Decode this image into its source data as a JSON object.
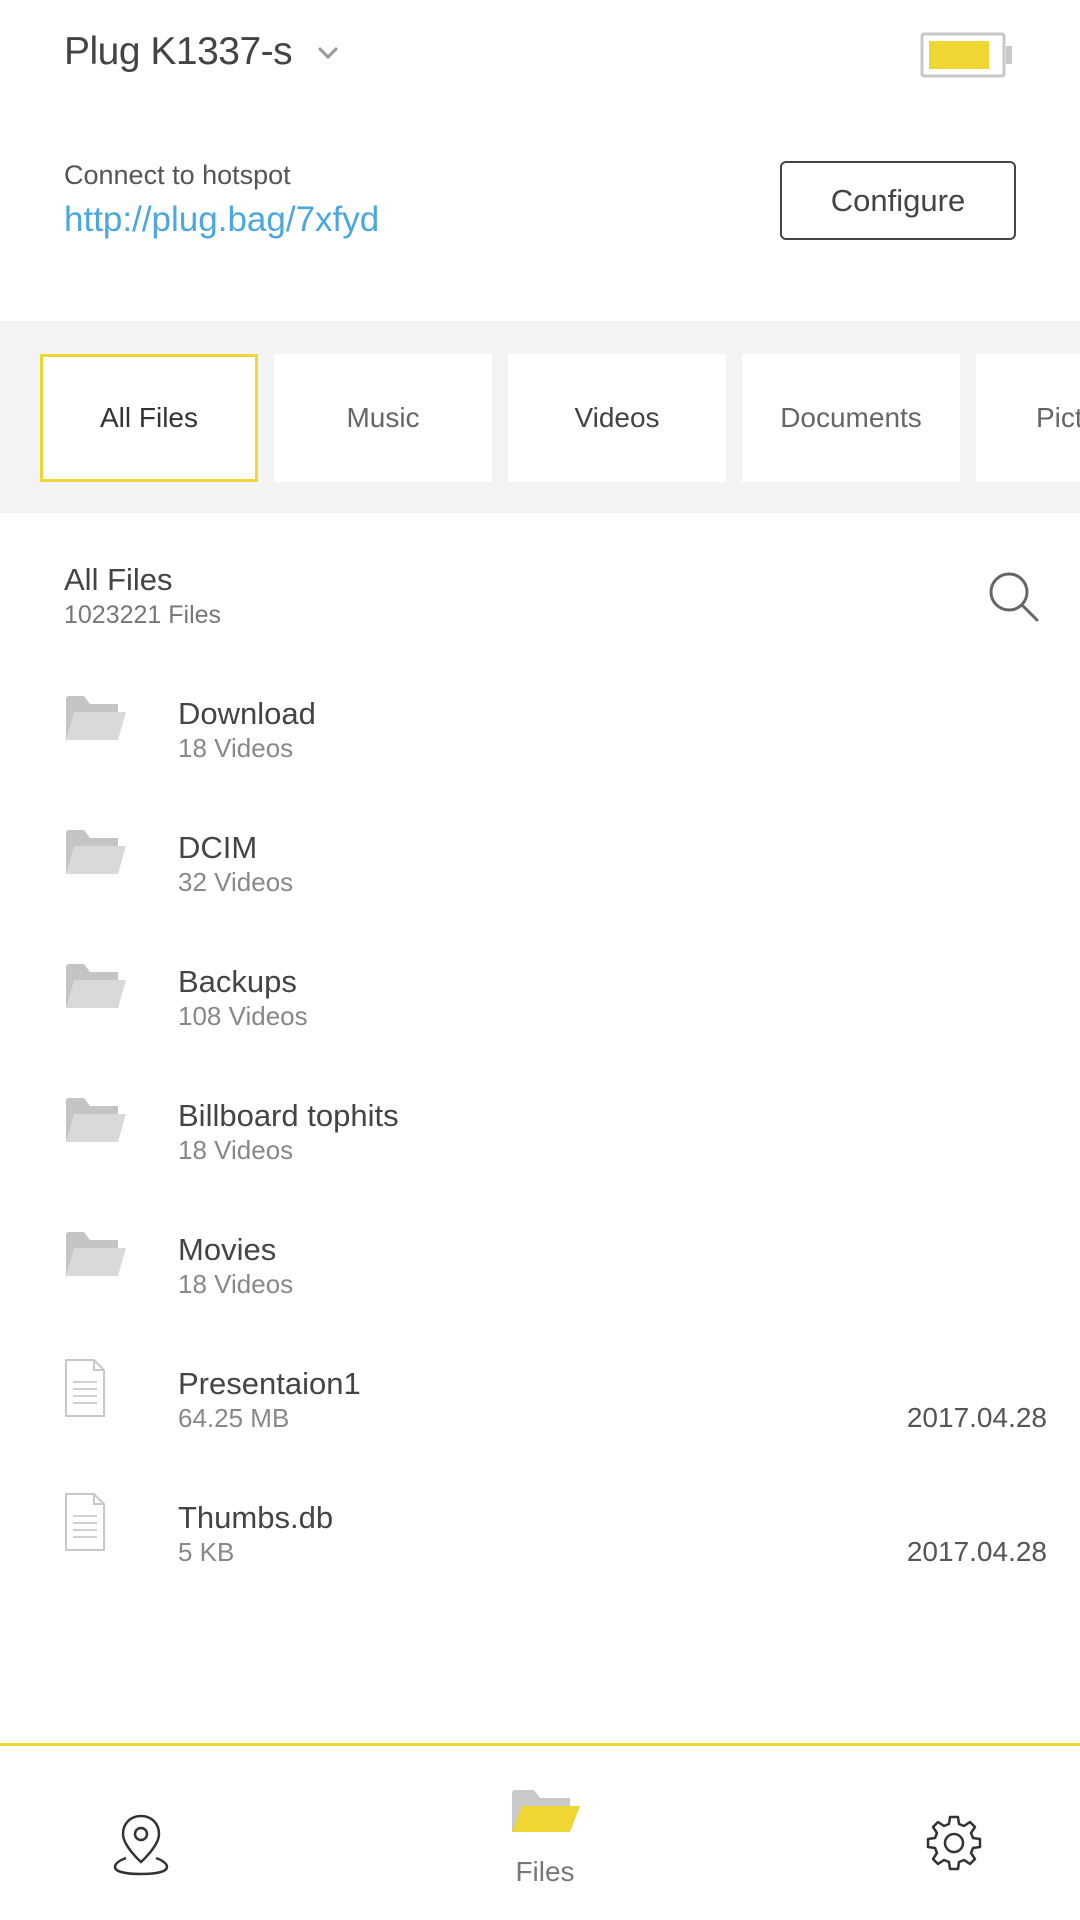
{
  "header": {
    "device_name": "Plug K1337-s",
    "hotspot_label": "Connect to hotspot",
    "hotspot_url": "http://plug.bag/7xfyd",
    "configure_label": "Configure",
    "battery_level": 0.85
  },
  "tabs": [
    {
      "label": "All Files",
      "active": true
    },
    {
      "label": "Music",
      "active": false
    },
    {
      "label": "Videos",
      "active": false
    },
    {
      "label": "Documents",
      "active": false
    },
    {
      "label": "Pict",
      "active": false
    }
  ],
  "section": {
    "title": "All Files",
    "count": "1023221 Files"
  },
  "files": [
    {
      "name": "Download",
      "sub": "18 Videos",
      "type": "folder",
      "date": ""
    },
    {
      "name": "DCIM",
      "sub": "32 Videos",
      "type": "folder",
      "date": ""
    },
    {
      "name": "Backups",
      "sub": "108 Videos",
      "type": "folder",
      "date": ""
    },
    {
      "name": "Billboard tophits",
      "sub": "18 Videos",
      "type": "folder",
      "date": ""
    },
    {
      "name": "Movies",
      "sub": "18 Videos",
      "type": "folder",
      "date": ""
    },
    {
      "name": "Presentaion1",
      "sub": "64.25 MB",
      "type": "document",
      "date": "2017.04.28"
    },
    {
      "name": "Thumbs.db",
      "sub": "5 KB",
      "type": "document",
      "date": "2017.04.28"
    }
  ],
  "bottom_nav": {
    "files_label": "Files",
    "active": "files",
    "icons": [
      "location-pin-icon",
      "folder-icon",
      "gear-icon"
    ]
  },
  "colors": {
    "accent": "#f0d633",
    "link": "#4aa7e0",
    "folder_gray": "#c4c4c4"
  }
}
